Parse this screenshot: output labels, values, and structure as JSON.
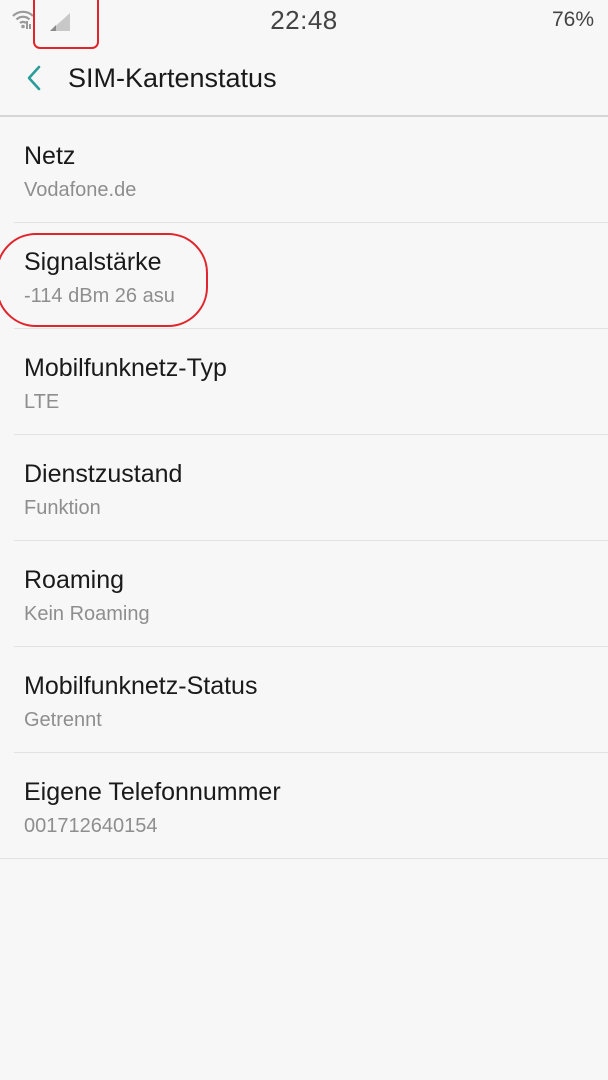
{
  "status_bar": {
    "time": "22:48",
    "battery": "76%",
    "icons": [
      "wifi-icon",
      "cell-signal-icon"
    ],
    "annotation_color": "#e0262c"
  },
  "app_bar": {
    "back_icon": "chevron-left-icon",
    "title": "SIM-Kartenstatus",
    "accent_color": "#2a9d9a"
  },
  "items": [
    {
      "title": "Netz",
      "value": "Vodafone.de"
    },
    {
      "title": "Signalstärke",
      "value": "-114 dBm 26 asu"
    },
    {
      "title": "Mobilfunknetz-Typ",
      "value": "LTE"
    },
    {
      "title": "Dienstzustand",
      "value": "Funktion"
    },
    {
      "title": "Roaming",
      "value": "Kein Roaming"
    },
    {
      "title": "Mobilfunknetz-Status",
      "value": "Getrennt"
    },
    {
      "title": "Eigene Telefonnummer",
      "value": "001712640154"
    }
  ]
}
